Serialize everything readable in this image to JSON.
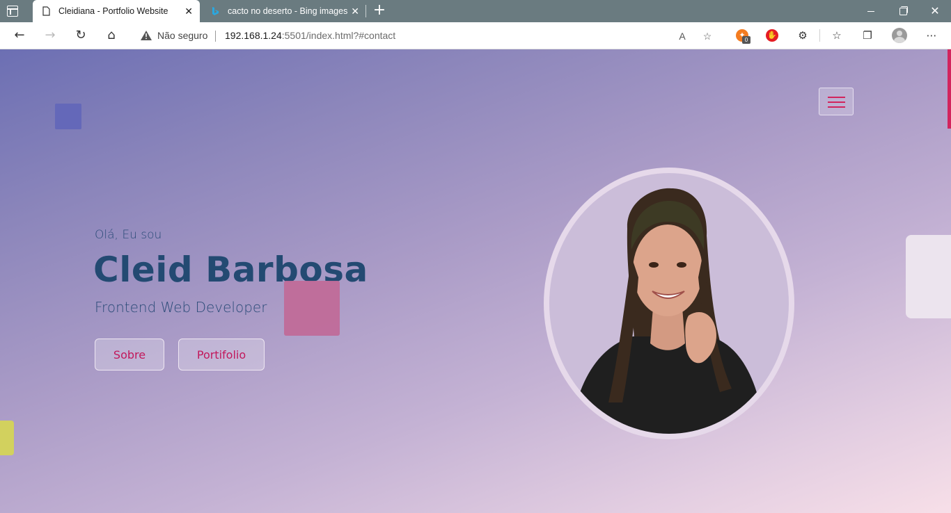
{
  "browser": {
    "tabs": [
      {
        "title": "Cleidiana - Portfolio Website",
        "active": true
      },
      {
        "title": "cacto no deserto - Bing images",
        "active": false
      }
    ],
    "address": {
      "security_label": "Não seguro",
      "url_host": "192.168.1.24",
      "url_rest": ":5501/index.html?#contact"
    },
    "extension_badge": "0"
  },
  "hero": {
    "greeting": "Olá, Eu sou",
    "name": "Cleid Barbosa",
    "role": "Frontend Web Developer",
    "buttons": {
      "about": "Sobre",
      "portfolio": "Portifolio"
    }
  },
  "colors": {
    "accent": "#d2245d",
    "heading": "#234a72",
    "tabbar": "#6a7b80"
  }
}
